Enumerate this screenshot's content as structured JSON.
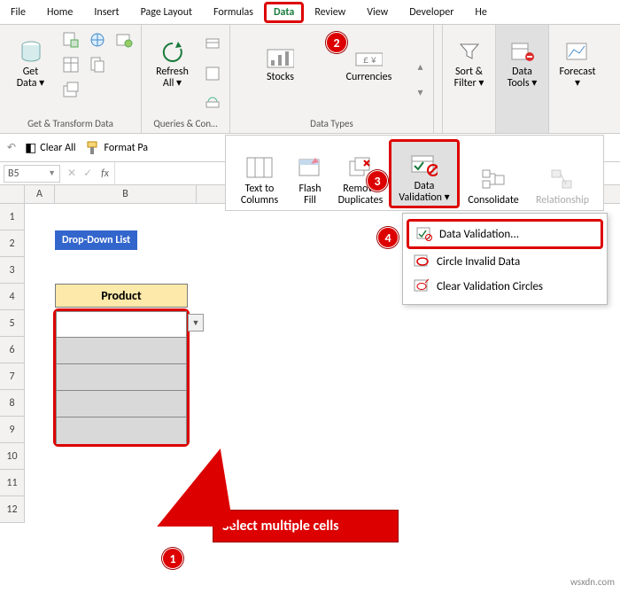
{
  "tabs": {
    "file": "File",
    "home": "Home",
    "insert": "Insert",
    "pagelayout": "Page Layout",
    "formulas": "Formulas",
    "data": "Data",
    "review": "Review",
    "view": "View",
    "developer": "Developer",
    "help": "He"
  },
  "ribbon": {
    "getdata": "Get\nData ▾",
    "getgroup": "Get & Transform Data",
    "refreshall": "Refresh\nAll ▾",
    "queriesgroup": "Queries & Con…",
    "stocks": "Stocks",
    "currencies": "Currencies",
    "datatypes": "Data Types",
    "sortfilter": "Sort &\nFilter ▾",
    "datatools": "Data\nTools ▾",
    "forecast": "Forecast\n▾"
  },
  "quickbar": {
    "clearall": "Clear All",
    "formatpa": "Format Pa"
  },
  "formulabar": {
    "namebox": "B5",
    "fx": "fx"
  },
  "sheet": {
    "cols": {
      "A": "A",
      "B": "B"
    },
    "rows": [
      "1",
      "2",
      "3",
      "4",
      "5",
      "6",
      "7",
      "8",
      "9",
      "10",
      "11",
      "12"
    ],
    "title": "Drop-Down List",
    "product_header": "Product"
  },
  "toolspanel": {
    "texttocolumns": "Text to\nColumns",
    "flashfill": "Flash\nFill",
    "removedup": "Remove\nDuplicates",
    "datavalidation": "Data\nValidation ▾",
    "consolidate": "Consolidate",
    "relationships": "Relationship"
  },
  "dvmenu": {
    "item1": "Data Validation...",
    "item2": "Circle Invalid Data",
    "item3": "Clear Validation Circles"
  },
  "callout": "Select multiple cells",
  "badges": {
    "b1": "1",
    "b2": "2",
    "b3": "3",
    "b4": "4"
  },
  "watermark": "wsxdn.com"
}
